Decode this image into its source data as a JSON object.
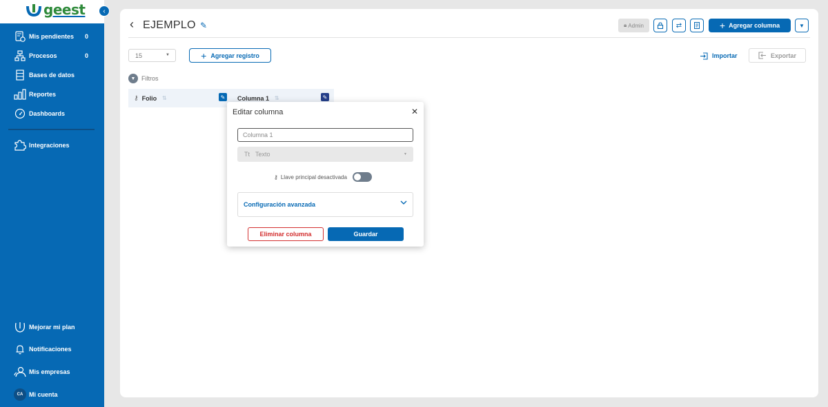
{
  "brand": {
    "logo_text": "geest",
    "logo_color": "#2e8a3a",
    "sidebar_color": "#0669b4"
  },
  "sidebar": {
    "collapse_icon": "chevron-left-icon",
    "items": [
      {
        "label": "Mis pendientes",
        "count": "0",
        "icon": "task-clock-icon"
      },
      {
        "label": "Procesos",
        "count": "0",
        "icon": "org-chart-icon"
      },
      {
        "label": "Bases de datos",
        "count": "",
        "icon": "table-icon"
      },
      {
        "label": "Reportes",
        "count": "",
        "icon": "bar-chart-icon"
      },
      {
        "label": "Dashboards",
        "count": "",
        "icon": "gauge-icon"
      },
      {
        "label": "Integraciones",
        "count": "",
        "icon": "puzzle-icon"
      }
    ],
    "bottom": [
      {
        "label": "Mejorar mi plan",
        "icon": "upgrade-icon"
      },
      {
        "label": "Notificaciones",
        "icon": "bell-icon"
      },
      {
        "label": "Mis empresas",
        "icon": "users-icon"
      },
      {
        "label": "Mi cuenta",
        "avatar": "CA"
      }
    ]
  },
  "header": {
    "title": "EJEMPLO",
    "admin_label": "Admin",
    "add_column_label": "Agregar columna",
    "accent_color": "#0669b4"
  },
  "toolbar": {
    "page_size": "15",
    "add_record_label": "Agregar registro",
    "import_label": "Importar",
    "export_label": "Exportar",
    "filters_label": "Filtros"
  },
  "table": {
    "columns": [
      {
        "label": "Folio"
      },
      {
        "label": "Columna 1"
      }
    ]
  },
  "modal": {
    "title": "Editar columna",
    "name_placeholder": "Columna 1",
    "type_label": "Texto",
    "type_icon": "Tt",
    "primary_key_label": "Llave principal desactivada",
    "advanced_label": "Configuración avanzada",
    "delete_label": "Eliminar columna",
    "save_label": "Guardar"
  }
}
